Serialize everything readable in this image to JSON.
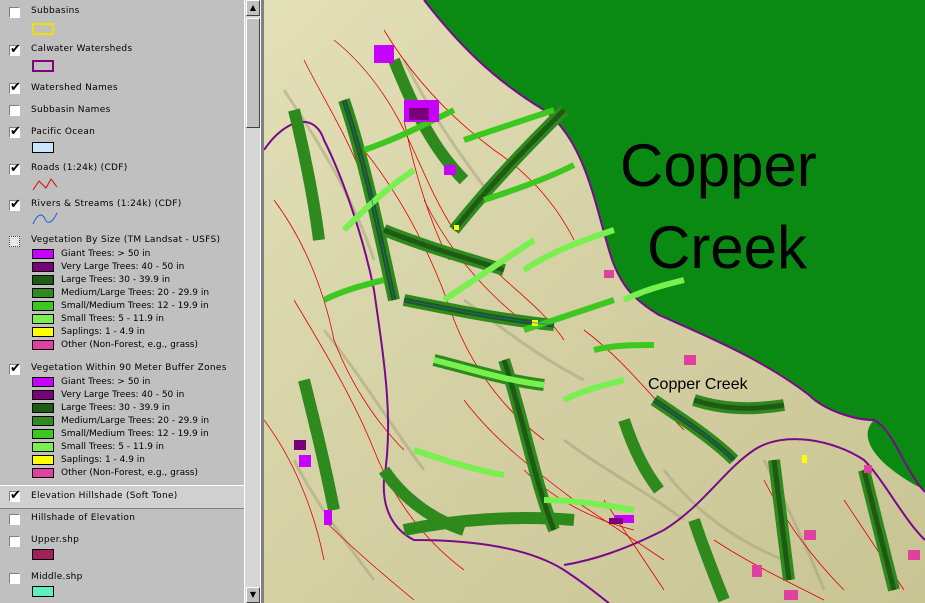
{
  "toc": {
    "layers": [
      {
        "label": "Subbasins",
        "checked": false
      },
      {
        "label": "Calwater Watersheds",
        "checked": true
      },
      {
        "label": "Watershed Names",
        "checked": true
      },
      {
        "label": "Subbasin Names",
        "checked": false
      },
      {
        "label": "Pacific Ocean",
        "checked": true
      },
      {
        "label": "Roads (1:24k) (CDF)",
        "checked": true
      },
      {
        "label": "Rivers & Streams (1:24k) (CDF)",
        "checked": true
      },
      {
        "label": "Vegetation By Size (TM Landsat - USFS)",
        "checked": false
      },
      {
        "label": "Vegetation Within 90 Meter Buffer Zones",
        "checked": true
      },
      {
        "label": "Elevation Hillshade (Soft Tone)",
        "checked": true
      },
      {
        "label": "Hillshade of Elevation",
        "checked": false
      },
      {
        "label": "Upper.shp",
        "checked": false
      },
      {
        "label": "Middle.shp",
        "checked": false
      }
    ],
    "veg_classes": [
      {
        "label": "Giant Trees: > 50 in",
        "color": "#c800ff"
      },
      {
        "label": "Very Large Trees: 40 - 50 in",
        "color": "#780078"
      },
      {
        "label": "Large Trees: 30 - 39.9 in",
        "color": "#1e5a14"
      },
      {
        "label": "Medium/Large Trees: 20 - 29.9 in",
        "color": "#2f8a1e"
      },
      {
        "label": "Small/Medium Trees: 12 - 19.9 in",
        "color": "#3cc81e"
      },
      {
        "label": "Small Trees: 5 - 11.9 in",
        "color": "#78f050"
      },
      {
        "label": "Saplings: 1 - 4.9 in",
        "color": "#ffff00"
      },
      {
        "label": "Other (Non-Forest, e.g., grass)",
        "color": "#e040a0"
      }
    ],
    "colors": {
      "subbasin_outline": "#f0e000",
      "watershed_outline": "#800080",
      "ocean_fill": "#c8e4ff",
      "roads": "#e00000",
      "rivers": "#2060e0",
      "upper_fill": "#a0205a",
      "middle_fill": "#60f0c0"
    }
  },
  "map": {
    "watershed_label_line1": "Copper",
    "watershed_label_line2": "Creek",
    "stream_label": "Copper Creek",
    "colors": {
      "watershed_fill": "#0a8a12",
      "terrain": "#d7d4a8",
      "boundary": "#7a0a8a"
    }
  }
}
